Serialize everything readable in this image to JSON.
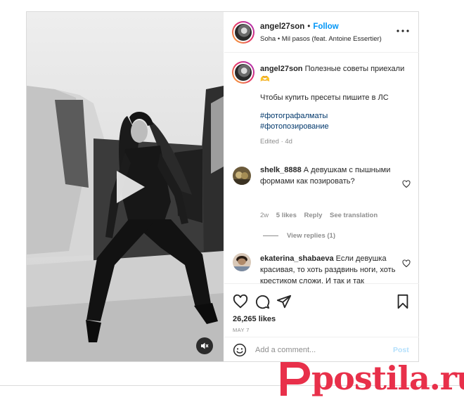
{
  "post": {
    "username": "angel27son",
    "follow_label": "Follow",
    "separator": "•",
    "audio": "Soha • Mil pasos (feat. Antoine Essertier)"
  },
  "caption": {
    "username": "angel27son",
    "line1": "Полезные советы приехали 🫶",
    "line2": "Чтобы купить пресеты пишите в ЛС",
    "hashtags": [
      "#фотографалматы",
      "#фотопозирование"
    ],
    "meta": "Edited · 4d"
  },
  "comments": [
    {
      "username": "shelk_8888",
      "text": "А девушкам с пышными формами как позировать?",
      "age": "2w",
      "likes": "5 likes",
      "reply": "Reply",
      "translate": "See translation",
      "view_replies": "View replies (1)"
    },
    {
      "username": "ekaterina_shabaeva",
      "text": "Если девушка красивая, то хоть раздвинь ноги, хоть крестиком сложи. И так и так"
    }
  ],
  "engagement": {
    "likes": "26,265 likes",
    "date": "MAY 7"
  },
  "composer": {
    "placeholder": "Add a comment...",
    "post_label": "Post"
  },
  "watermark": {
    "text": "postila.ru",
    "color": "#e8304a"
  },
  "icons": [
    "play-icon",
    "mute-icon",
    "more-icon",
    "heart-icon",
    "comment-icon",
    "share-icon",
    "bookmark-icon",
    "emoji-icon"
  ]
}
